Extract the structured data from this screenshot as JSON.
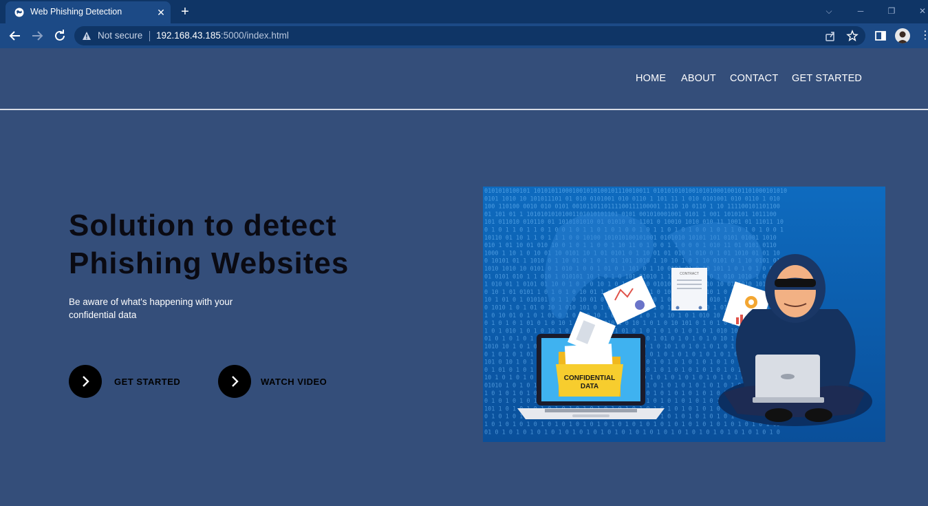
{
  "browser": {
    "tab_title": "Web Phishing Detection",
    "security_label": "Not secure",
    "url_host": "192.168.43.185",
    "url_rest": ":5000/index.html"
  },
  "nav": {
    "items": [
      "HOME",
      "ABOUT",
      "CONTACT",
      "GET STARTED"
    ]
  },
  "hero": {
    "title_line1": "Solution to detect",
    "title_line2": "Phishing Websites",
    "subtitle_line1": "Be aware of what's happening with your",
    "subtitle_line2": "confidential data",
    "cta_primary": "GET STARTED",
    "cta_secondary": "WATCH VIDEO"
  },
  "illustration": {
    "folder_label_line1": "CONFIDENTIAL",
    "folder_label_line2": "DATA",
    "contract_label": "CONTRACT",
    "binary_rows": [
      "0101010100101 101010110001001010100101110010011 01010101010010101000100101101000101010",
      "0101 1010 10 101011101 01 010 0101001 010 0110 1 101 11 1 010 0101001 010 0110 1 010",
      "100 110100 0010 010 0101 0010110110111100111100001 1110 10 0110 1 10 111100101101100",
      "01 101 01 1 10101010101001101010101101 0101 001010001001 0101 1 001 1010101 1011100",
      "101 011010 010110 01 1010101010 01 01010 01 1101 0 10010 1010 010 11 1001 01 11011 10",
      "0 1 0 1 1 0 1 1 0 1 0 0 1 0 1 1 0 1 0 1 0 0 1 0 1 1 0 1 0 1 0 0 1 0 1 1 0 1 0 1 0 0 1",
      "10110 01 10 1 1 0 1 1 1 0 0 10100 101010100101001 0101010 10101 101 0101 01001 1010",
      "010 1 01 10 01 010 10 0 1 0 1 1 0 0 1 10 11 0 1 0 0 1 1 0 0 0 1 010 11 01 0101 0110",
      "1000 1 10 1 0 10 01 10 0101 10 1 01 0101 0 1 10 01 01 010 1 010 0 1 01 1010 01 01 10",
      "0 10101 01 1 1010 0 1 10 01 0 1 0 1 01 101 1010 1 10 10 1 0 1 10 0101 0 1 10 0101 01",
      "1010 1010 10 0101 0 1 010 1 0 0 1 01 0 1 101 0 1 10 0101 01 0 10 101 1 0 1 0 1 0 0 1",
      "01 0101 010 1 1 010 1 010101 10 1 0 1 0 101 01010 1 10 010 10 1 0 1 010 1010 1 0 10",
      "1 010 01 1 0101 01 10 0 1 0 1 0 10 1 0 1 0 1 10 01010 1 0 1 1 010 10 01 1010 101010",
      "0 10 1 01 0101 1 0 1 0 1 0 10 01 1 0 1 010 101 1 0 10 1 01 0 1010 1 0 1 1 0 010 1010",
      "10 1 01 0 1 010101 0 1 1 0 10 01 0 1 0 1 0 1 0 10 1 01 010 10 1 010 1 0 1 010 101 01",
      "0 1010 1 0 1 01 0 10 1 010 101 0 1 0 1 0 1 0 10 1 0 1 010 10 1 0 1 010 10 1 0 101 10",
      "1 0 10 01 0 1 0 1 01 0 1 0 1 0 10 1 0 1 010 1 0 1 0 10 1 0 1 010 10 1 01 0 1 0 1 010",
      "0 1 0 1 0 1 01 0 1 0 10 1 0 1 0 1 010 1 0 10 1 0 1 0 10 101 0 1 0 1 0 1 0 1 0 10 101",
      "1 0 1 010 1 0 1 0 10 1 0 1 0 1 0 1 0 1 01 0 1 0 1 0 1 0 1 0 1 0 1 010 10 1 0 1 0 1 0",
      "01 0 1 0 1 0 1 0 1 01 0 1 0 1 0 1 0 1 0 1 0 1 0 1 01 0 1 0 1 0 1 0 10 1 0 1 0 1 0 10",
      "1010 10 1 0 1 0 1 0 10 1 0 1 0 1 0 1 0 1 0 1 0 1 0 10 1 0 1 0 1 0 1 0 1 0 1 0 1 01 0",
      "0 1 0 1 0 1 01 0 1 0 1 0 1 0 1 0 1 0 1 0 1 0 1 0 1 0 1 0 1 0 1 0 1 0 1 0 1 0 10 1 01",
      "101 0 10 1 0 1 0 1 0 1 0 1 0 1 0 10 1 0 1 0 1 0 1 0 1 0 1 0 1 0 1 0 1 0 1 0 1 0 1 01",
      "0 1 01 0 1 0 1 0 1 0 1 0 1 0 1 0 1 0 1 0 1 0 10 1 0 1 0 1 0 1 0 1 0 1 0 1 0 1 0 1 0 1",
      "10 1 0 1 0 1 0 1 0 1 0 1 0 1 0 1 0 1 0 1 0 1 0 1 0 1 0 1 0 1 0 1 0 1 0 1 0 1 0 1 0 1",
      "01010 1 0 1 0 1 0 1 0 1 0 1 0 1 0 1 0 1 0 1 0 1 0 1 0 1 0 1 0 1 0 1 0 1 0 1 0 1 0 10",
      "1 0 1 0 1 0 1 0 1 0 1 0 1 0 1 0 1 0 1 0 1 0 1 0 1 0 1 0 1 0 1 0 1 0 1 0 1 0 1 0 1 01",
      "0 1 0 1 0 1 0 1 0 1 0 1 0 1 0 1 0 1 0 1 0 1 0 1 0 1 0 1 0 1 0 1 0 1 0 1 0 1 0 1 0 10",
      "101 1 0 1 0 1 0 1 0 1 0 1 0 1 0 1 0 1 0 1 0 1 0 1 0 1 0 1 0 1 0 1 0 1 0 1 0 1 0 1 01",
      "0 1 0 1 0 1 0 1 0 1 0 1 0 1 0 1 0 1 0 1 0 1 0 1 0 1 0 1 0 1 0 1 0 1 0 1 0 1 0 1 0 11",
      "1 0 1 0 1 0 1 0 1 0 1 0 1 0 1 0 1 0 1 0 1 0 1 0 1 0 1 0 1 0 1 0 1 0 1 0 1 0 1 0 1 00",
      "01 0 1 0 1 0 1 0 1 0 1 0 1 0 1 0 1 0 1 0 1 0 1 0 1 0 1 0 1 0 1 0 1 0 1 0 1 0 1 0 1 0"
    ]
  },
  "colors": {
    "page_bg": "#344e7a",
    "title_text": "#0a0a12",
    "cta_circle": "#000000",
    "illustration_bg": "#0b5fa8"
  }
}
